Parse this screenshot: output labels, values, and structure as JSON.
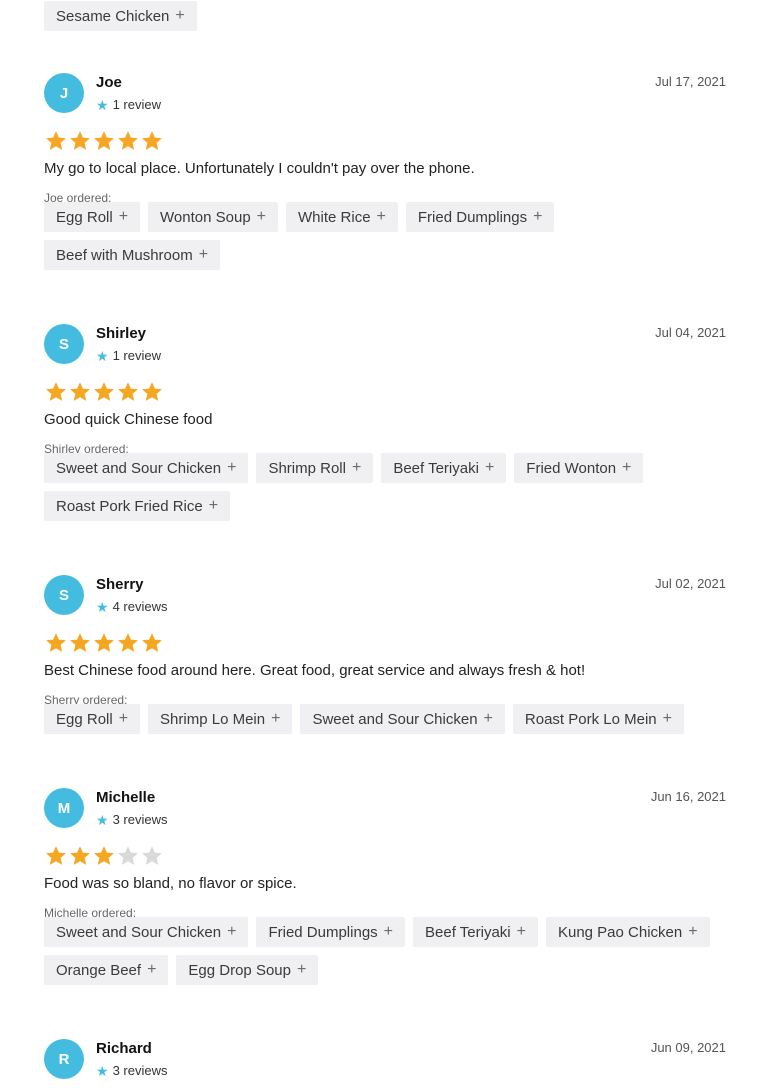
{
  "top_ordered_items": [
    "Sesame Chicken"
  ],
  "plus_symbol": "+",
  "reviews": [
    {
      "initial": "J",
      "name": "Joe",
      "review_count": "1 review",
      "date": "Jul 17, 2021",
      "rating": 5,
      "text": "My go to local place. Unfortunately I couldn't pay over the phone.",
      "ordered_label": "Joe ordered:",
      "items": [
        "Egg Roll",
        "Wonton Soup",
        "White Rice",
        "Fried Dumplings",
        "Beef with Mushroom"
      ]
    },
    {
      "initial": "S",
      "name": "Shirley",
      "review_count": "1 review",
      "date": "Jul 04, 2021",
      "rating": 5,
      "text": "Good quick Chinese food",
      "ordered_label": "Shirley ordered:",
      "items": [
        "Sweet and Sour Chicken",
        "Shrimp Roll",
        "Beef Teriyaki",
        "Fried Wonton",
        "Roast Pork Fried Rice"
      ]
    },
    {
      "initial": "S",
      "name": "Sherry",
      "review_count": "4 reviews",
      "date": "Jul 02, 2021",
      "rating": 5,
      "text": "Best Chinese food around here. Great food, great service and always fresh & hot!",
      "ordered_label": "Sherry ordered:",
      "items": [
        "Egg Roll",
        "Shrimp Lo Mein",
        "Sweet and Sour Chicken",
        "Roast Pork Lo Mein"
      ]
    },
    {
      "initial": "M",
      "name": "Michelle",
      "review_count": "3 reviews",
      "date": "Jun 16, 2021",
      "rating": 3,
      "text": "Food was so bland, no flavor or spice.",
      "ordered_label": "Michelle ordered:",
      "items": [
        "Sweet and Sour Chicken",
        "Fried Dumplings",
        "Beef Teriyaki",
        "Kung Pao Chicken",
        "Orange Beef",
        "Egg Drop Soup"
      ]
    },
    {
      "initial": "R",
      "name": "Richard",
      "review_count": "3 reviews",
      "date": "Jun 09, 2021",
      "rating": null,
      "text": "",
      "ordered_label": "",
      "items": []
    }
  ],
  "colors": {
    "avatar": "#44bce0",
    "star_filled": "#f5a623",
    "star_empty": "#d9d9d9",
    "small_star": "#44bce0",
    "tag_bg": "#f0f0f2"
  }
}
